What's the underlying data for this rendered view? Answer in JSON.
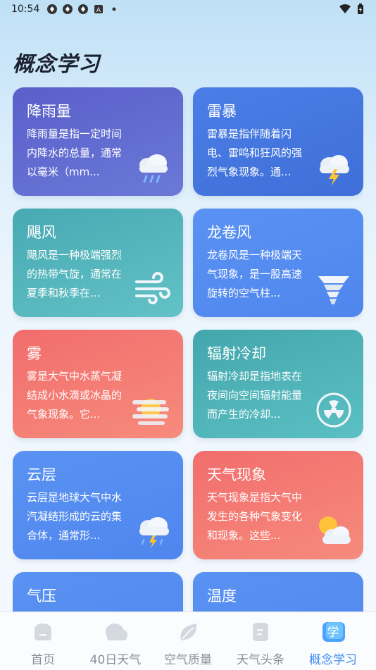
{
  "status": {
    "time": "10:54",
    "notif_badge": "A"
  },
  "page": {
    "title": "概念学习"
  },
  "cards": [
    {
      "title": "降雨量",
      "desc": "降雨量是指一定时间内降水的总量，通常以毫米（mm...",
      "icon": "rain-cloud-icon",
      "color_from": "#5a5fc9",
      "color_to": "#6a79d8"
    },
    {
      "title": "雷暴",
      "desc": "雷暴是指伴随着闪电、雷鸣和狂风的强烈气象现象。通...",
      "icon": "thunderstorm-icon",
      "color_from": "#4a7ee6",
      "color_to": "#3f6fd8"
    },
    {
      "title": "飓风",
      "desc": "飓风是一种极端强烈的热带气旋，通常在夏季和秋季在...",
      "icon": "wind-icon",
      "color_from": "#47a9b3",
      "color_to": "#63c2c6"
    },
    {
      "title": "龙卷风",
      "desc": "龙卷风是一种极端天气现象，是一股高速旋转的空气柱...",
      "icon": "tornado-icon",
      "color_from": "#5a92f2",
      "color_to": "#4f86ee"
    },
    {
      "title": "雾",
      "desc": "雾是大气中水蒸气凝结成小水滴或冰晶的气象现象。它...",
      "icon": "fog-icon",
      "color_from": "#f26d6d",
      "color_to": "#f68b7c"
    },
    {
      "title": "辐射冷却",
      "desc": "辐射冷却是指地表在夜间向空间辐射能量而产生的冷却...",
      "icon": "radiation-icon",
      "color_from": "#43a6ad",
      "color_to": "#5bc0c3"
    },
    {
      "title": "云层",
      "desc": "云层是地球大气中水汽凝结形成的云的集合体，通常形...",
      "icon": "storm-cloud-icon",
      "color_from": "#5a92f2",
      "color_to": "#4f86ee"
    },
    {
      "title": "天气现象",
      "desc": "天气现象是指大气中发生的各种气象变化和现象。这些...",
      "icon": "sun-cloud-icon",
      "color_from": "#f26d6d",
      "color_to": "#f68b7c"
    },
    {
      "title": "气压",
      "desc": "",
      "icon": "",
      "color_from": "#5a92f2",
      "color_to": "#4f86ee"
    },
    {
      "title": "温度",
      "desc": "",
      "icon": "",
      "color_from": "#5a92f2",
      "color_to": "#4f86ee"
    }
  ],
  "tabs": [
    {
      "label": "首页",
      "icon": "home-icon",
      "active": false
    },
    {
      "label": "40日天气",
      "icon": "cloud-icon",
      "active": false
    },
    {
      "label": "空气质量",
      "icon": "leaf-icon",
      "active": false
    },
    {
      "label": "天气头条",
      "icon": "news-icon",
      "active": false
    },
    {
      "label": "概念学习",
      "icon": "learn-icon",
      "icon_text": "学",
      "active": true
    }
  ],
  "colors": {
    "accent": "#3d8bf0",
    "tab_inactive": "#8a8f99"
  }
}
